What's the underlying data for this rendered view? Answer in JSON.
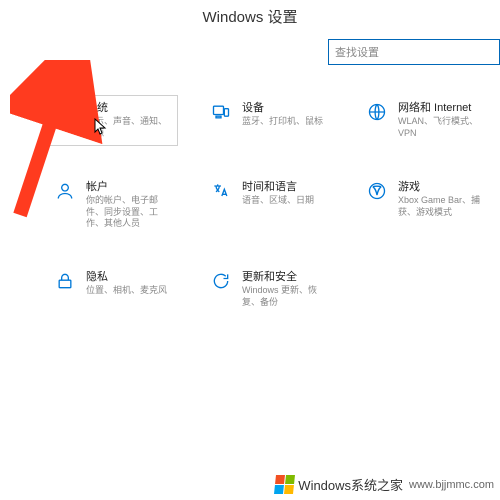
{
  "header": {
    "title": "Windows 设置"
  },
  "search": {
    "placeholder": "查找设置"
  },
  "tiles": {
    "system": {
      "title": "系统",
      "sub": "显示、声音、通知、电源"
    },
    "devices": {
      "title": "设备",
      "sub": "蓝牙、打印机、鼠标"
    },
    "network": {
      "title": "网络和 Internet",
      "sub": "WLAN、飞行模式、VPN"
    },
    "accounts": {
      "title": "帐户",
      "sub": "你的帐户、电子邮件、同步设置、工作、其他人员"
    },
    "time": {
      "title": "时间和语言",
      "sub": "语音、区域、日期"
    },
    "gaming": {
      "title": "游戏",
      "sub": "Xbox Game Bar、捕获、游戏模式"
    },
    "privacy": {
      "title": "隐私",
      "sub": "位置、相机、麦克风"
    },
    "update": {
      "title": "更新和安全",
      "sub": "Windows 更新、恢复、备份"
    }
  },
  "watermark": {
    "brand": "Windows系统之家",
    "url": "www.bjjmmc.com"
  }
}
